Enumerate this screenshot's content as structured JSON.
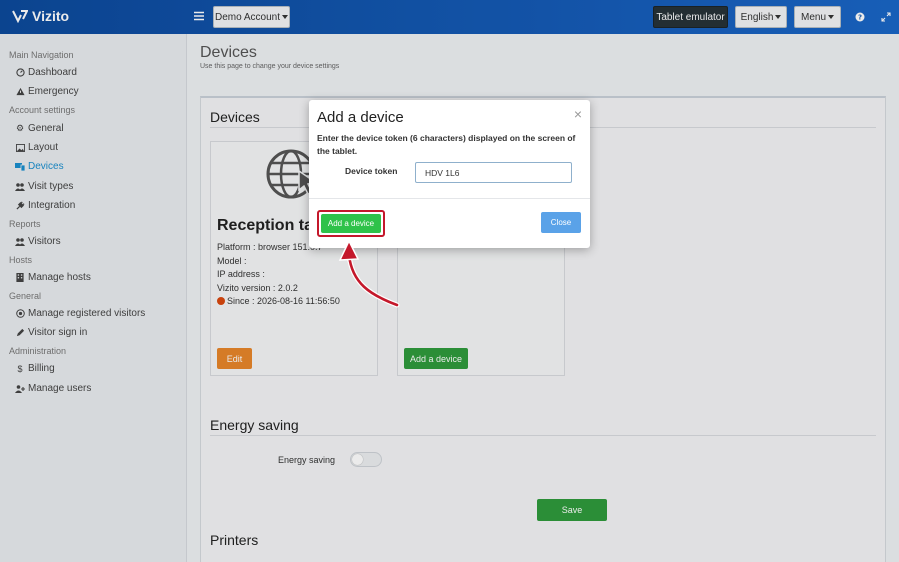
{
  "app": {
    "brand": "Vizito"
  },
  "topbar": {
    "account": "Demo Account",
    "tablet_emulator": "Tablet emulator",
    "language": "English",
    "menu": "Menu"
  },
  "sidebar": {
    "sections": [
      {
        "title": "Main Navigation",
        "items": [
          {
            "label": "Dashboard",
            "icon": "dashboard-icon"
          },
          {
            "label": "Emergency",
            "icon": "warning-icon"
          }
        ]
      },
      {
        "title": "Account settings",
        "items": [
          {
            "label": "General",
            "icon": "gear-icon"
          },
          {
            "label": "Layout",
            "icon": "image-icon"
          },
          {
            "label": "Devices",
            "icon": "devices-icon",
            "active": true
          },
          {
            "label": "Visit types",
            "icon": "users-icon"
          },
          {
            "label": "Integration",
            "icon": "plug-icon"
          }
        ]
      },
      {
        "title": "Reports",
        "items": [
          {
            "label": "Visitors",
            "icon": "users-icon"
          }
        ]
      },
      {
        "title": "Hosts",
        "items": [
          {
            "label": "Manage hosts",
            "icon": "building-icon"
          }
        ]
      },
      {
        "title": "General",
        "items": [
          {
            "label": "Manage registered visitors",
            "icon": "target-icon"
          },
          {
            "label": "Visitor sign in",
            "icon": "pencil-icon"
          }
        ]
      },
      {
        "title": "Administration",
        "items": [
          {
            "label": "Billing",
            "icon": "dollar-icon"
          },
          {
            "label": "Manage users",
            "icon": "user-plus-icon"
          }
        ]
      }
    ]
  },
  "page": {
    "title": "Devices",
    "subtitle": "Use this page to change your device settings"
  },
  "devices_section": {
    "title": "Devices",
    "card": {
      "name": "Reception tabl",
      "platform": "Platform : browser 151.0.7",
      "model": "Model :",
      "ip": "IP address :",
      "version": "Vizito version : 2.0.2",
      "since": "Since : 2026-08-16 11:56:50",
      "edit": "Edit"
    },
    "add_card": {
      "button": "Add a device"
    }
  },
  "energy_section": {
    "title": "Energy saving",
    "label": "Energy saving",
    "toggle_on": false,
    "save": "Save"
  },
  "printers_section": {
    "title": "Printers"
  },
  "modal": {
    "title": "Add a device",
    "close_symbol": "×",
    "instructions": "Enter the device token (6 characters) displayed on the screen of the tablet.",
    "token_label": "Device token",
    "token_value": "HDV 1L6",
    "add_button": "Add a device",
    "close_button": "Close"
  },
  "colors": {
    "accent": "#1a8fcf",
    "green": "#2fc24a",
    "orange": "#e8862a",
    "highlight_red": "#c4182b",
    "status_dot": "#d9480f"
  }
}
